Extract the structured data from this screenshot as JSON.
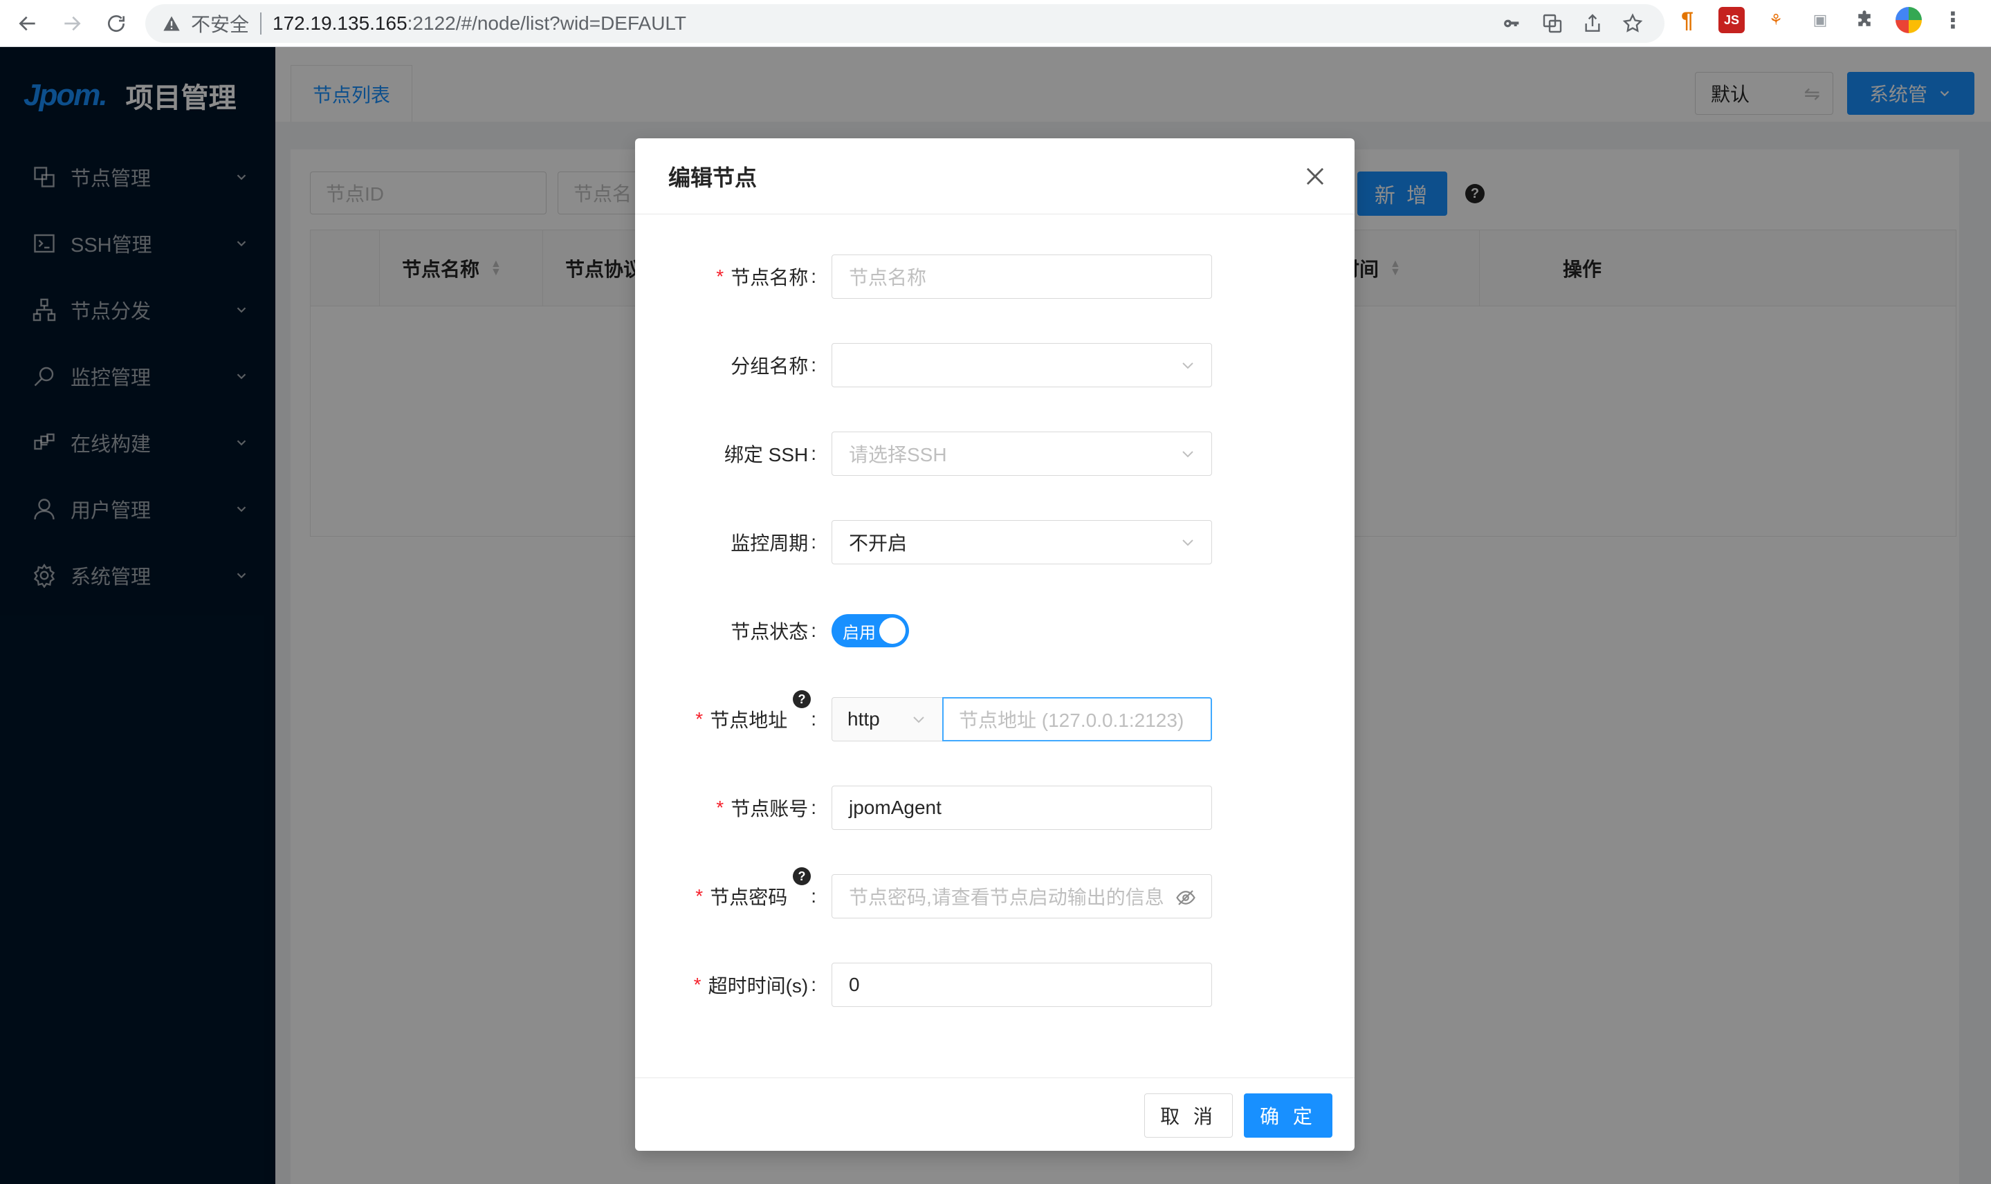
{
  "browser": {
    "insecure_label": "不安全",
    "url_host": "172.19.135.165",
    "url_path": ":2122/#/node/list?wid=DEFAULT",
    "extensions": [
      {
        "name": "paragraph-ext",
        "text": "¶",
        "color": "#e37400"
      },
      {
        "name": "js-ext",
        "text": "JS",
        "color": "#c5221f"
      },
      {
        "name": "tree-ext",
        "text": "⚘",
        "color": "#e8710a"
      },
      {
        "name": "box-ext",
        "text": "▣",
        "color": "#9aa0a6"
      },
      {
        "name": "puzzle-ext",
        "text": "✱",
        "color": "#5f6368"
      }
    ]
  },
  "sidebar": {
    "logo": "Jpom.",
    "title": "项目管理",
    "items": [
      {
        "label": "节点管理",
        "icon": "cluster-icon"
      },
      {
        "label": "SSH管理",
        "icon": "terminal-icon"
      },
      {
        "label": "节点分发",
        "icon": "apartment-icon"
      },
      {
        "label": "监控管理",
        "icon": "monitor-icon"
      },
      {
        "label": "在线构建",
        "icon": "build-icon"
      },
      {
        "label": "用户管理",
        "icon": "user-icon"
      },
      {
        "label": "系统管理",
        "icon": "setting-icon"
      }
    ]
  },
  "header": {
    "tab": "节点列表",
    "workspace": "默认",
    "workspace_swap": "⇋",
    "system_button": "系统管"
  },
  "list": {
    "search_node_id": "节点ID",
    "search_node_name": "节点名",
    "add_button": "新 增",
    "columns": [
      "节点名称",
      "节点协议",
      "更新时间",
      "操作"
    ]
  },
  "modal": {
    "title": "编辑节点",
    "fields": {
      "name_label": "节点名称",
      "name_placeholder": "节点名称",
      "group_label": "分组名称",
      "group_value": "",
      "ssh_label": "绑定 SSH",
      "ssh_placeholder": "请选择SSH",
      "cycle_label": "监控周期",
      "cycle_value": "不开启",
      "status_label": "节点状态",
      "status_value": "启用",
      "address_label": "节点地址",
      "protocol_value": "http",
      "address_placeholder": "节点地址 (127.0.0.1:2123)",
      "account_label": "节点账号",
      "account_value": "jpomAgent",
      "password_label": "节点密码",
      "password_placeholder": "节点密码,请查看节点启动输出的信息",
      "timeout_label": "超时时间(s)",
      "timeout_value": "0"
    },
    "colon": ":",
    "cancel": "取 消",
    "ok": "确 定"
  }
}
